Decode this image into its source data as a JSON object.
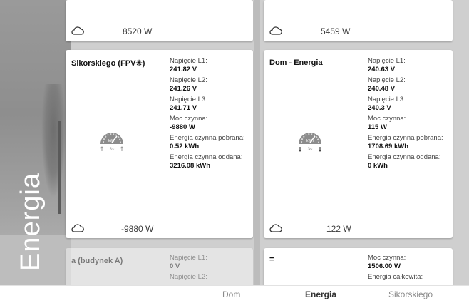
{
  "side": {
    "title": "Energia"
  },
  "top_cards": [
    {
      "power": "8520 W",
      "icon": "cloud-icon"
    },
    {
      "power": "5459 W",
      "icon": "cloud-icon"
    }
  ],
  "cards": [
    {
      "name": "Sikorskiego (FPV✳)",
      "power": "-9880 W",
      "readings": [
        {
          "label": "Napięcie L1:",
          "value": "241.82 V"
        },
        {
          "label": "Napięcie L2:",
          "value": "241.26 V"
        },
        {
          "label": "Napięcie L3:",
          "value": "241.71 V"
        },
        {
          "label": "Moc czynna:",
          "value": "-9880 W"
        },
        {
          "label": "Energia czynna pobrana:",
          "value": "0.52 kWh"
        },
        {
          "label": "Energia czynna oddana:",
          "value": "3216.08 kWh"
        }
      ],
      "gauge_label": "kWh",
      "gauge_phase": "3~",
      "gauge_direction": "up"
    },
    {
      "name": "Dom - Energia",
      "power": "122 W",
      "readings": [
        {
          "label": "Napięcie L1:",
          "value": "240.63 V"
        },
        {
          "label": "Napięcie L2:",
          "value": "240.48 V"
        },
        {
          "label": "Napięcie L3:",
          "value": "240.3 V"
        },
        {
          "label": "Moc czynna:",
          "value": "115 W"
        },
        {
          "label": "Energia czynna pobrana:",
          "value": "1708.69 kWh"
        },
        {
          "label": "Energia czynna oddana:",
          "value": "0 kWh"
        }
      ],
      "gauge_label": "kWh",
      "gauge_phase": "3~",
      "gauge_direction": "down"
    }
  ],
  "bottom_cards": [
    {
      "name": "a (budynek A)",
      "readings": [
        {
          "label": "Napięcie L1:",
          "value": "0 V"
        },
        {
          "label": "Napięcie L2:",
          "value": ""
        }
      ]
    },
    {
      "name": "=",
      "readings": [
        {
          "label": "Moc czynna:",
          "value": "1506.00 W"
        },
        {
          "label": "Energia całkowita:",
          "value": ""
        }
      ]
    }
  ],
  "tabs": [
    {
      "label": "Dom",
      "active": false
    },
    {
      "label": "Energia",
      "active": true
    },
    {
      "label": "Sikorskiego",
      "active": false
    }
  ]
}
